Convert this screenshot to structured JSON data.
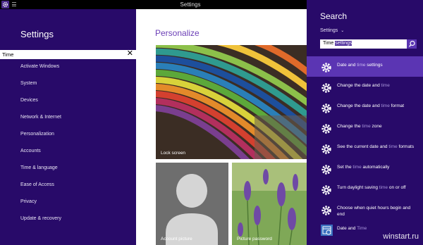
{
  "window": {
    "title": "Settings"
  },
  "left": {
    "title": "Settings",
    "search_value": "Time",
    "nav": [
      "Activate Windows",
      "System",
      "Devices",
      "Network & Internet",
      "Personalization",
      "Accounts",
      "Time & language",
      "Ease of Access",
      "Privacy",
      "Update & recovery"
    ]
  },
  "center": {
    "title": "Personalize",
    "tiles": {
      "lock": "Lock screen",
      "account": "Account picture",
      "picture_password": "Picture password"
    }
  },
  "charm": {
    "title": "Search",
    "scope": "Settings",
    "query_plain": "Time ",
    "query_selected": "settings",
    "results": [
      {
        "pre": "Date and ",
        "hl": "time",
        "post": " settings",
        "icon": "gear-icon"
      },
      {
        "pre": "Change the date and ",
        "hl": "time",
        "post": "",
        "icon": "gear-icon"
      },
      {
        "pre": "Change the date and ",
        "hl": "time",
        "post": " format",
        "icon": "gear-icon"
      },
      {
        "pre": "Change the ",
        "hl": "time",
        "post": " zone",
        "icon": "gear-icon"
      },
      {
        "pre": "See the current date and ",
        "hl": "time",
        "post": " formats",
        "icon": "gear-icon"
      },
      {
        "pre": "Set the ",
        "hl": "time",
        "post": " automatically",
        "icon": "gear-icon"
      },
      {
        "pre": "Turn daylight saving ",
        "hl": "time",
        "post": " on or off",
        "icon": "gear-icon"
      },
      {
        "pre": "Choose when quiet hours begin and end",
        "hl": "",
        "post": "",
        "icon": "gear-icon"
      },
      {
        "pre": "Date and ",
        "hl": "Time",
        "post": "",
        "icon": "app-tile-icon"
      }
    ]
  },
  "watermark": "winstart.ru",
  "colors": {
    "accent": "#280a69",
    "highlight": "#5b35b3",
    "title_purple": "#6b3fb6"
  }
}
